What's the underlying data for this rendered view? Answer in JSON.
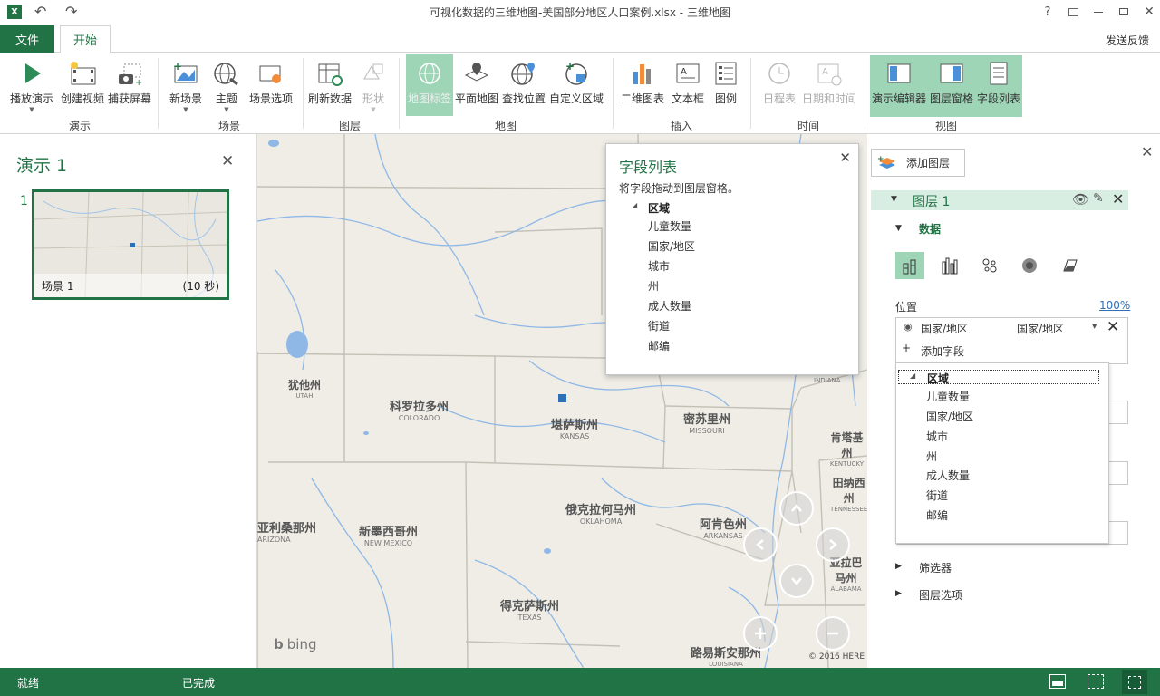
{
  "titlebar": {
    "title": "可视化数据的三维地图-美国部分地区人口案例.xlsx - 三维地图",
    "help": "?"
  },
  "tabs": {
    "file": "文件",
    "home": "开始",
    "feedback": "发送反馈"
  },
  "ribbon": {
    "buttons": {
      "play": "播放演示",
      "create_video": "创建视频",
      "capture": "捕获屏幕",
      "new_scene": "新场景",
      "theme": "主题",
      "scene_options": "场景选项",
      "refresh": "刷新数据",
      "shapes": "形状",
      "map_labels": "地图标签",
      "flat_map": "平面地图",
      "find_location": "查找位置",
      "custom_regions": "自定义区域",
      "chart_2d": "二维图表",
      "textbox": "文本框",
      "legend": "图例",
      "timeline": "日程表",
      "datetime": "日期和时间",
      "tour_editor": "演示编辑器",
      "layer_pane": "图层窗格",
      "field_list": "字段列表"
    },
    "groups": {
      "tour": "演示",
      "scene": "场景",
      "layer": "图层",
      "map": "地图",
      "insert": "插入",
      "time": "时间",
      "view": "视图"
    }
  },
  "tour_pane": {
    "title": "演示 1",
    "scene_number": "1",
    "scene_name": "场景 1",
    "scene_duration": "(10 秒)"
  },
  "map": {
    "labels": [
      {
        "cn": "犹他州",
        "en": "UTAH"
      },
      {
        "cn": "科罗拉多州",
        "en": "COLORADO"
      },
      {
        "cn": "堪萨斯州",
        "en": "KANSAS"
      },
      {
        "cn": "密苏里州",
        "en": "MISSOURI"
      },
      {
        "cn": "肯塔基州",
        "en": "KENTUCKY"
      },
      {
        "cn": "田纳西州",
        "en": "TENNESSEE"
      },
      {
        "cn": "亚利桑那州",
        "en": "ARIZONA"
      },
      {
        "cn": "新墨西哥州",
        "en": "NEW MEXICO"
      },
      {
        "cn": "俄克拉何马州",
        "en": "OKLAHOMA"
      },
      {
        "cn": "阿肯色州",
        "en": "ARKANSAS"
      },
      {
        "cn": "亚拉巴马州",
        "en": "ALABAMA"
      },
      {
        "cn": "得克萨斯州",
        "en": "TEXAS"
      },
      {
        "cn": "路易斯安那州",
        "en": "LOUISIANA"
      }
    ],
    "bing": "bing",
    "copyright": "© 2016 HERE",
    "indiana": "INDIANA"
  },
  "field_list": {
    "title": "字段列表",
    "subtitle": "将字段拖动到图层窗格。",
    "group": "区域",
    "fields": [
      "儿童数量",
      "国家/地区",
      "城市",
      "州",
      "成人数量",
      "街道",
      "邮编"
    ]
  },
  "layer_pane": {
    "add_layer": "添加图层",
    "layer_name": "图层 1",
    "data_section": "数据",
    "location_label": "位置",
    "zoom": "100%",
    "location_field": "国家/地区",
    "location_type": "国家/地区",
    "add_field": "添加字段",
    "dropdown_group": "区域",
    "dropdown_fields": [
      "儿童数量",
      "国家/地区",
      "城市",
      "州",
      "成人数量",
      "街道",
      "邮编"
    ],
    "filters": "筛选器",
    "layer_options": "图层选项"
  },
  "statusbar": {
    "ready": "就绪",
    "done": "已完成"
  },
  "colors": {
    "accent": "#217346",
    "active": "#9fd5b7",
    "map_bg": "#efede6",
    "water": "#8fb8e6"
  }
}
